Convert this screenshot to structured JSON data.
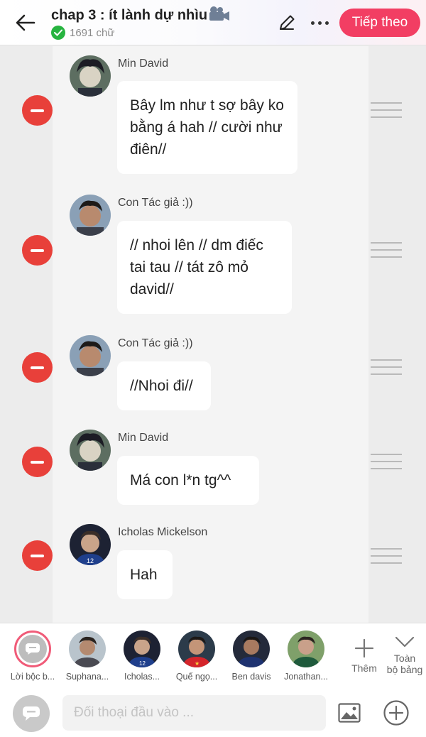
{
  "header": {
    "title": "chap 3 : ít lành dự nhìu",
    "word_count": "1691 chữ",
    "next_label": "Tiếp theo"
  },
  "messages": [
    {
      "author": "Min David",
      "text": "Bây lm như t sợ bây ko bằng á hah // cười như điên//"
    },
    {
      "author": "Con Tác giả :))",
      "text": "// nhoi lên // dm điếc tai tau // tát zô mỏ david//"
    },
    {
      "author": "Con Tác giả :))",
      "text": "//Nhoi đi//"
    },
    {
      "author": "Min David",
      "text": "Má con l*n tg^^"
    },
    {
      "author": "Icholas Mickelson",
      "text": "Hah"
    }
  ],
  "characters": [
    {
      "label": "Lời bộc b..."
    },
    {
      "label": "Suphana..."
    },
    {
      "label": "Icholas..."
    },
    {
      "label": "Quế ngọ..."
    },
    {
      "label": "Ben davis"
    },
    {
      "label": "Jonathan..."
    }
  ],
  "actions": {
    "add_label": "Thêm",
    "all_label_1": "Toàn",
    "all_label_2": "bộ bảng"
  },
  "input": {
    "placeholder": "Đối thoại đầu vào ..."
  },
  "colors": {
    "accent": "#f23e63",
    "remove": "#e8403a",
    "verified": "#27b43f"
  }
}
